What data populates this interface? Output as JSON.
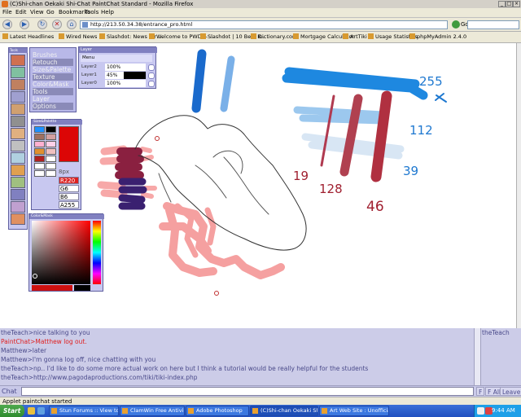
{
  "window": {
    "title": "(C)Shi-chan Oekaki Shi-Chat PaintChat Standard - Mozilla Firefox"
  },
  "menubar": {
    "items": [
      "File",
      "Edit",
      "View",
      "Go",
      "Bookmarks",
      "Tools",
      "Help"
    ]
  },
  "nav": {
    "url": "http://213.50.34.38/entrance_pro.html",
    "go_label": "Go"
  },
  "bookmarks": [
    "Latest Headlines",
    "Wired News",
    "Slashdot: News for ...",
    "Welcome to PWD! - ...",
    "Slashdot | 10 Best R...",
    "Dictionary.com",
    "Mortgage Calculator",
    "ArtTiki",
    "Usage Statistics",
    "phpMyAdmin 2.4.0"
  ],
  "applet": {
    "tools_header": "Tools",
    "menu_items": [
      {
        "label": "Brushes",
        "dark": false
      },
      {
        "label": "Retouch",
        "dark": true
      },
      {
        "label": "Size&Palette",
        "dark": false
      },
      {
        "label": "Texture",
        "dark": true
      },
      {
        "label": "Color&Mask",
        "dark": false
      },
      {
        "label": "Tools",
        "dark": true
      },
      {
        "label": "Layer",
        "dark": false
      },
      {
        "label": "Options",
        "dark": true
      }
    ],
    "layer_panel": {
      "header": "Layer",
      "menu_label": "Menu",
      "layers": [
        {
          "name": "Layer2",
          "opacity": "100%",
          "fill": 100
        },
        {
          "name": "Layer1",
          "opacity": "45%",
          "fill": 45
        },
        {
          "name": "Layer0",
          "opacity": "100%",
          "fill": 100
        }
      ]
    },
    "size_palette": {
      "header": "Size&Palette",
      "size_label": "8px",
      "r": "R220",
      "g": "G6",
      "b": "B6",
      "a": "A255",
      "swatches": [
        "#1e90ff",
        "#000000",
        "#a07060",
        "#d4a0a0",
        "#ffb0d0",
        "#ffd0e8",
        "#e09030",
        "#f0c0c0",
        "#b02020",
        "#ffffff",
        "#ffffff",
        "#ffffff",
        "#ffffff",
        "#ffffff"
      ],
      "main_color": "#dc0606"
    },
    "color_mask": {
      "header": "Color&Mask"
    },
    "annotations": {
      "a": "255",
      "b": "112",
      "c": "39",
      "d": "19",
      "e": "128",
      "f": "46"
    }
  },
  "chat": {
    "lines": [
      {
        "text": "theTeach>nice talking to you",
        "red": false
      },
      {
        "text": "PaintChat>Matthew log out.",
        "red": true
      },
      {
        "text": "Matthew>later",
        "red": false
      },
      {
        "text": "Matthew>I'm gonna log off, nice chatting with you",
        "red": false
      },
      {
        "text": "theTeach>np.. I'd like to do some more actual work on here but I think a tutorial would be really helpful for the students",
        "red": false
      },
      {
        "text": "theTeach>http://www.pagodaproductions.com/tiki/tiki-index.php",
        "red": false
      }
    ],
    "users": [
      "theTeach"
    ],
    "input_label": "Chat",
    "buttons": [
      "F",
      "F All",
      "Leave"
    ]
  },
  "status": {
    "text": "Applet paintchat started"
  },
  "taskbar": {
    "start": "Start",
    "tasks": [
      {
        "label": "Stun Forums :: View topic...",
        "active": false
      },
      {
        "label": "ClamWin Free Antivirus",
        "active": false
      },
      {
        "label": "Adobe Photoshop",
        "active": false
      },
      {
        "label": "(C)Shi-chan Oekaki Sh...",
        "active": true
      },
      {
        "label": "Art Web Site : Unofficial ...",
        "active": false
      }
    ],
    "clock": "9:44 AM"
  }
}
